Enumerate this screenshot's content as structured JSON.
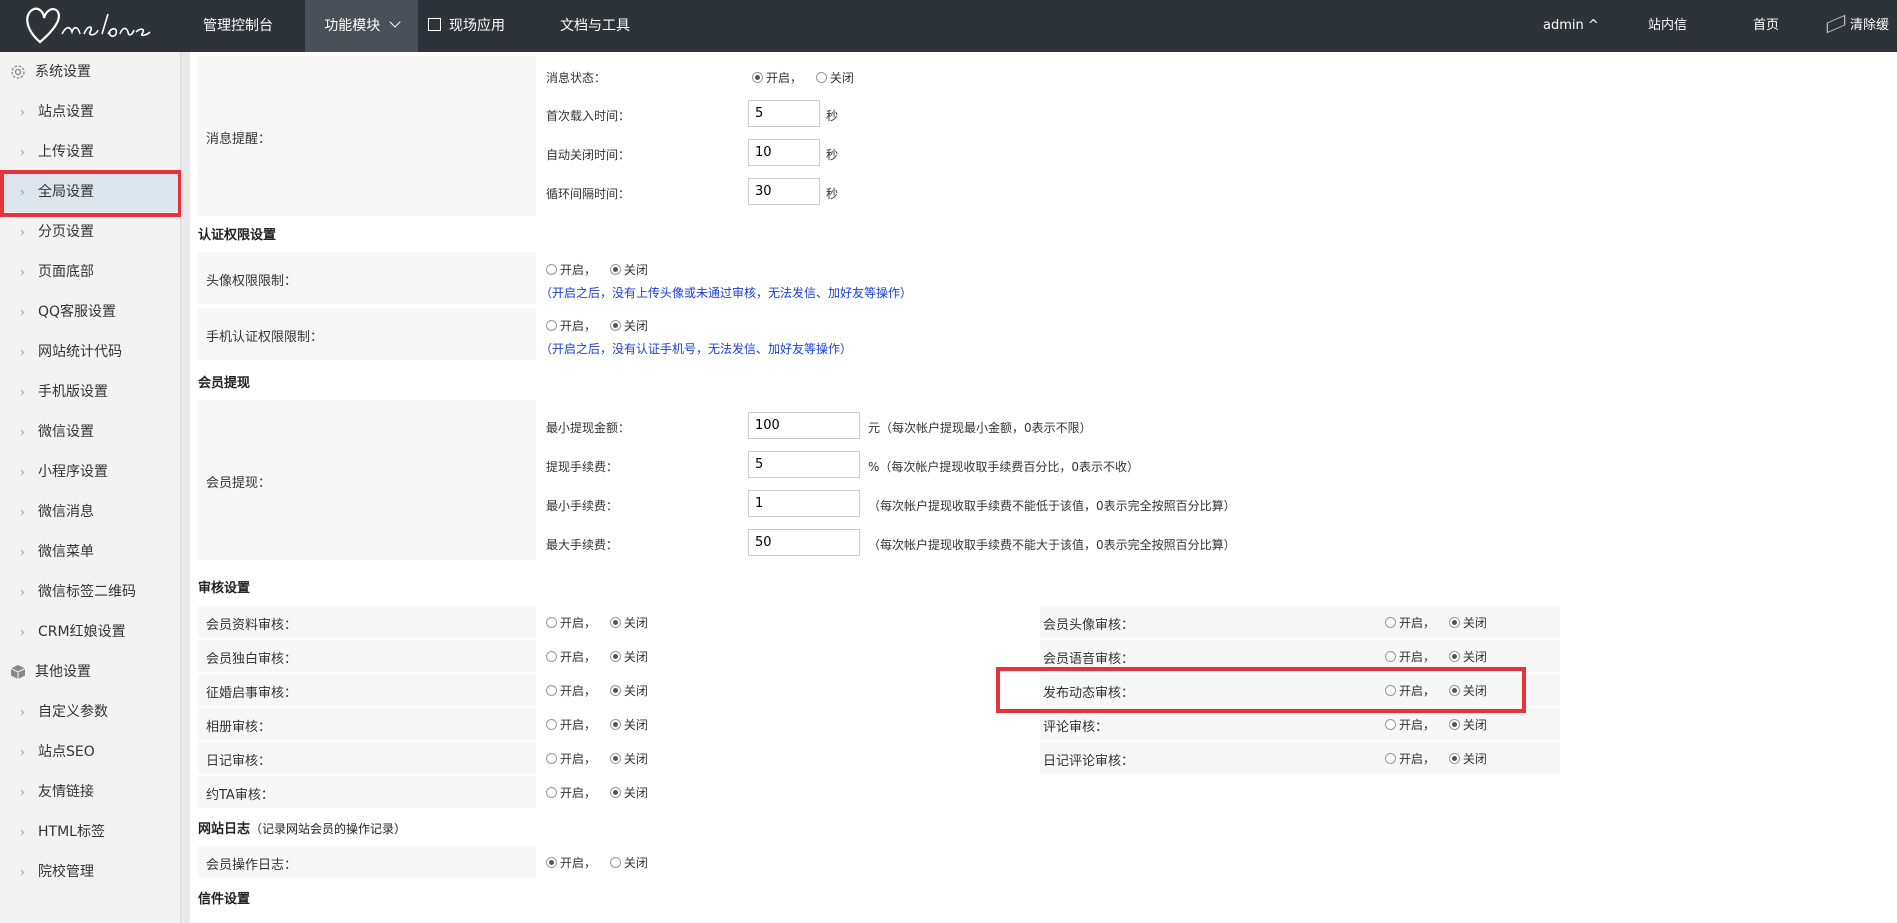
{
  "header": {
    "nav": [
      "管理控制台",
      "功能模块",
      "现场应用",
      "文档与工具"
    ],
    "right": [
      "admin ^",
      "站内信",
      "首页",
      "清除缓存"
    ]
  },
  "sidebar": {
    "group1": "系统设置",
    "items1": [
      "站点设置",
      "上传设置",
      "全局设置",
      "分页设置",
      "页面底部",
      "QQ客服设置",
      "网站统计代码",
      "手机版设置",
      "微信设置",
      "小程序设置",
      "微信消息",
      "微信菜单",
      "微信标签二维码",
      "CRM红娘设置"
    ],
    "group2": "其他设置",
    "items2": [
      "自定义参数",
      "站点SEO",
      "友情链接",
      "HTML标签",
      "院校管理"
    ]
  },
  "radio": {
    "on": "开启，",
    "off": "关闭"
  },
  "msg": {
    "label": "消息提醒：",
    "status_label": "消息状态：",
    "first_load_label": "首次载入时间：",
    "first_load_value": "5",
    "auto_close_label": "自动关闭时间：",
    "auto_close_value": "10",
    "loop_label": "循环间隔时间：",
    "loop_value": "30",
    "unit": "秒"
  },
  "auth": {
    "title": "认证权限设置",
    "avatar_label": "头像权限限制：",
    "avatar_note": "（开启之后，没有上传头像或未通过审核，无法发信、加好友等操作）",
    "mobile_label": "手机认证权限限制：",
    "mobile_note": "（开启之后，没有认证手机号，无法发信、加好友等操作）"
  },
  "withdraw": {
    "title": "会员提现",
    "label": "会员提现：",
    "min_amount_label": "最小提现金额：",
    "min_amount_value": "100",
    "min_amount_note": "元（每次帐户提现最小金额，0表示不限）",
    "fee_label": "提现手续费：",
    "fee_value": "5",
    "fee_note": "%（每次帐户提现收取手续费百分比，0表示不收）",
    "min_fee_label": "最小手续费：",
    "min_fee_value": "1",
    "min_fee_note": "（每次帐户提现收取手续费不能低于该值，0表示完全按照百分比算）",
    "max_fee_label": "最大手续费：",
    "max_fee_value": "50",
    "max_fee_note": "（每次帐户提现收取手续费不能大于该值，0表示完全按照百分比算）"
  },
  "audit": {
    "title": "审核设置",
    "left": [
      "会员资料审核：",
      "会员独白审核：",
      "征婚启事审核：",
      "相册审核：",
      "日记审核：",
      "约TA审核："
    ],
    "right": [
      "会员头像审核：",
      "会员语音审核：",
      "发布动态审核：",
      "评论审核：",
      "日记评论审核："
    ]
  },
  "log": {
    "title": "网站日志",
    "title_note": "（记录网站会员的操作记录）",
    "label": "会员操作日志："
  },
  "mail": {
    "title": "信件设置"
  }
}
